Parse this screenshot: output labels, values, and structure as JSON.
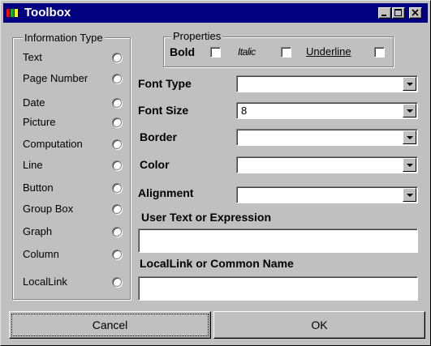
{
  "window": {
    "title": "Toolbox"
  },
  "info_group": {
    "legend": "Information Type",
    "items": [
      "Text",
      "Page Number",
      "Date",
      "Picture",
      "Computation",
      "Line",
      "Button",
      "Group Box",
      "Graph",
      "Column",
      "LocalLink"
    ]
  },
  "properties": {
    "legend": "Properties",
    "bold": "Bold",
    "italic": "Italic",
    "underline": "Underline"
  },
  "fields": {
    "font_type": {
      "label": "Font Type",
      "value": ""
    },
    "font_size": {
      "label": "Font Size",
      "value": "8"
    },
    "border": {
      "label": "Border",
      "value": ""
    },
    "color": {
      "label": "Color",
      "value": ""
    },
    "alignment": {
      "label": "Alignment",
      "value": ""
    }
  },
  "user_text": {
    "label": "User Text or Expression",
    "value": ""
  },
  "locallink": {
    "label": "LocalLink or Common Name",
    "value": ""
  },
  "buttons": {
    "cancel": "Cancel",
    "ok": "OK"
  }
}
